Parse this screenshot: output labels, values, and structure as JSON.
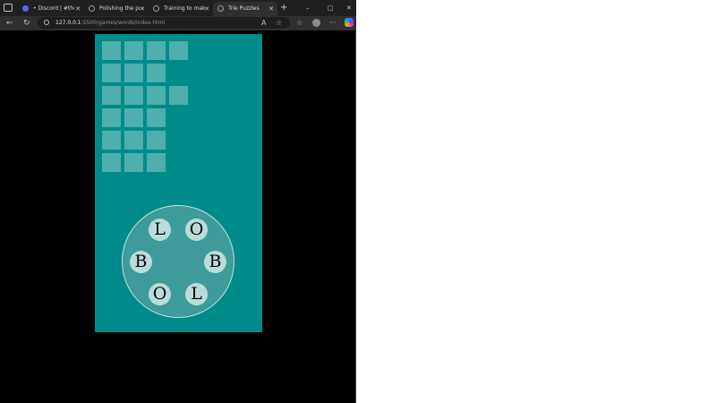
{
  "browser": {
    "tabs": [
      {
        "label": "• Discord | #the-cod",
        "icon": "discord-icon",
        "active": false
      },
      {
        "label": "Polishing the puzzle",
        "icon": "globe-icon",
        "active": false
      },
      {
        "label": "Training to make a W",
        "icon": "globe-icon",
        "active": false
      },
      {
        "label": "Trie Puzzles",
        "icon": "globe-icon",
        "active": true
      }
    ],
    "new_tab_glyph": "+",
    "address": {
      "host": "127.0.0.1",
      "path": ":5500/games/words/index.html"
    },
    "window_controls": [
      "–",
      "□",
      "✕"
    ]
  },
  "game": {
    "grid_rows": [
      4,
      3,
      4,
      3,
      3,
      3
    ],
    "wheel_letters": [
      "L",
      "O",
      "B",
      "B",
      "O",
      "L"
    ],
    "colors": {
      "board": "#008b8b",
      "cell": "#5cb5b3",
      "wheel": "#3e9b99",
      "letter_bg": "#b9dcda"
    }
  }
}
